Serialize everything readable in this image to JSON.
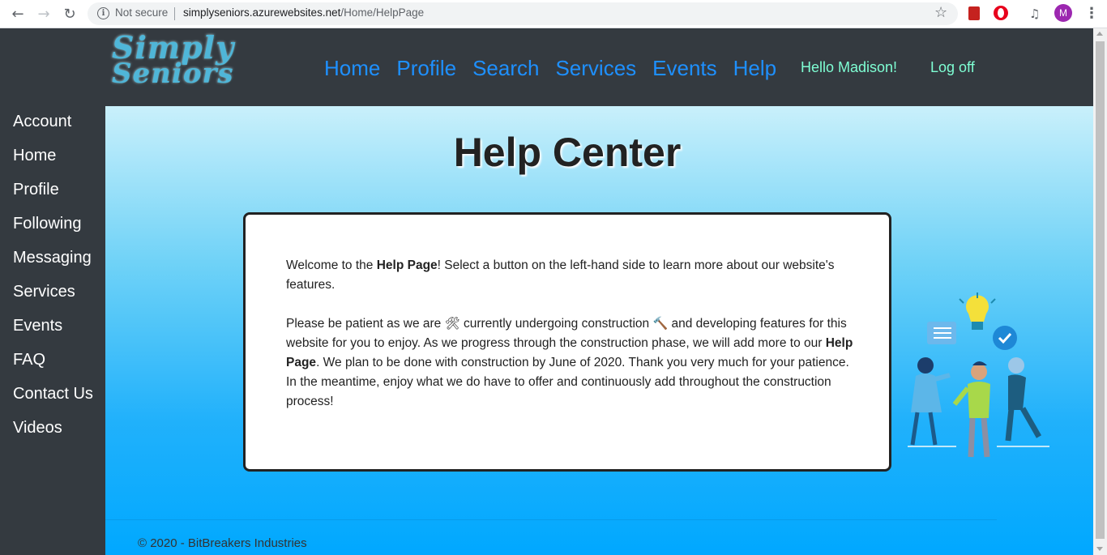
{
  "browser": {
    "security": "Not secure",
    "url_host": "simplyseniors.azurewebsites.net",
    "url_path": "/Home/HelpPage",
    "profile_initial": "M"
  },
  "logo": {
    "line1": "Simply",
    "line2": "Seniors"
  },
  "topnav": [
    "Home",
    "Profile",
    "Search",
    "Services",
    "Events",
    "Help"
  ],
  "user": {
    "greeting": "Hello Madison!",
    "logoff": "Log off"
  },
  "sidebar": [
    "Account",
    "Home",
    "Profile",
    "Following",
    "Messaging",
    "Services",
    "Events",
    "FAQ",
    "Contact Us",
    "Videos"
  ],
  "main": {
    "title": "Help Center",
    "p1_a": "Welcome to the ",
    "p1_bold": "Help Page",
    "p1_b": "! Select a button on the left-hand side to learn more about our website's features.",
    "p2_a": "Please be patient as we are ",
    "p2_b": " currently undergoing construction ",
    "p2_c": " and developing features for this website for you to enjoy. As we progress through the construction phase, we will add more to our ",
    "p2_bold": "Help Page",
    "p2_d": ". We plan to be done with construction by June of 2020. Thank you very much for your patience. In the meantime, enjoy what we do have to offer and continuously add throughout the construction process!",
    "emoji_tools": "🛠",
    "emoji_hammer": "🔨"
  },
  "footer": "© 2020 - BitBreakers Industries",
  "colors": {
    "nav_link": "#1e90ff",
    "user_link": "#7fffd4",
    "sidebar_bg": "#343a40"
  }
}
